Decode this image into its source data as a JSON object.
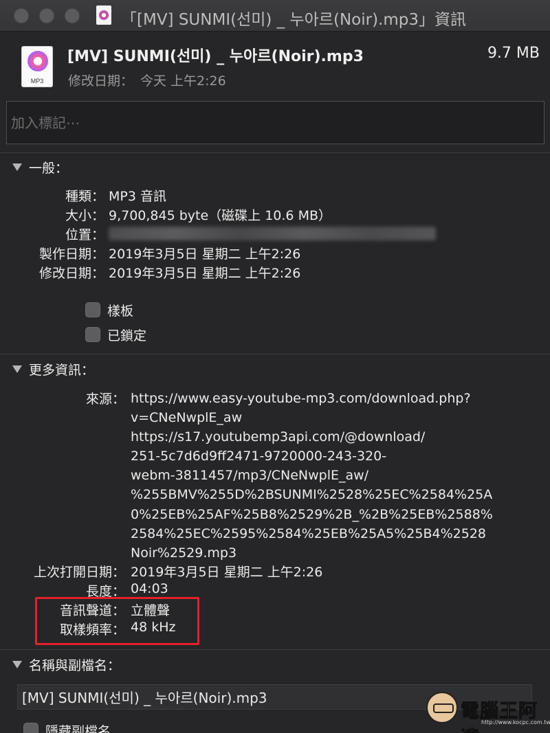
{
  "window": {
    "title": "「[MV] SUNMI(선미) _ 누아르(Noir).mp3」資訊"
  },
  "header": {
    "file_name": "[MV] SUNMI(선미) _ 누아르(Noir).mp3",
    "file_size": "9.7 MB",
    "icon_label": "MP3",
    "modified_label": "修改日期：",
    "modified_value": "今天 上午2:26"
  },
  "tags": {
    "placeholder": "加入標記⋯"
  },
  "general": {
    "header": "一般：",
    "rows": [
      {
        "label": "種類：",
        "value": "MP3 音訊"
      },
      {
        "label": "大小：",
        "value": "9,700,845 byte（磁碟上 10.6 MB）"
      },
      {
        "label": "位置：",
        "value": ""
      },
      {
        "label": "製作日期：",
        "value": "2019年3月5日 星期二 上午2:26"
      },
      {
        "label": "修改日期：",
        "value": "2019年3月5日 星期二 上午2:26"
      }
    ],
    "stationery_label": "樣板",
    "locked_label": "已鎖定"
  },
  "more_info": {
    "header": "更多資訊：",
    "source_label": "來源：",
    "source_lines": [
      "https://www.easy-youtube-mp3.com/download.php?",
      "v=CNeNwplE_aw",
      "https://s17.youtubemp3api.com/@download/",
      "251-5c7d6d9ff2471-9720000-243-320-",
      "webm-3811457/mp3/CNeNwplE_aw/",
      "%255BMV%255D%2BSUNMI%2528%25EC%2584%25A",
      "0%25EB%25AF%25B8%2529%2B_%2B%25EB%2588%",
      "2584%25EC%2595%2584%25EB%25A5%25B4%2528",
      "Noir%2529.mp3"
    ],
    "rows": [
      {
        "label": "上次打開日期：",
        "value": "2019年3月5日 星期二 上午2:26"
      },
      {
        "label": "長度：",
        "value": "04:03"
      },
      {
        "label": "音訊聲道：",
        "value": "立體聲"
      },
      {
        "label": "取樣頻率：",
        "value": "48 kHz"
      }
    ]
  },
  "name_ext": {
    "header": "名稱與副檔名：",
    "value": "[MV] SUNMI(선미) _ 누아르(Noir).mp3",
    "hide_ext_label": "隱藏副檔名"
  },
  "watermark": {
    "text": "電腦王阿達",
    "url": "http://www.kocpc.com.tw"
  },
  "colors": {
    "background": "#262628",
    "highlight": "#e5202a"
  }
}
